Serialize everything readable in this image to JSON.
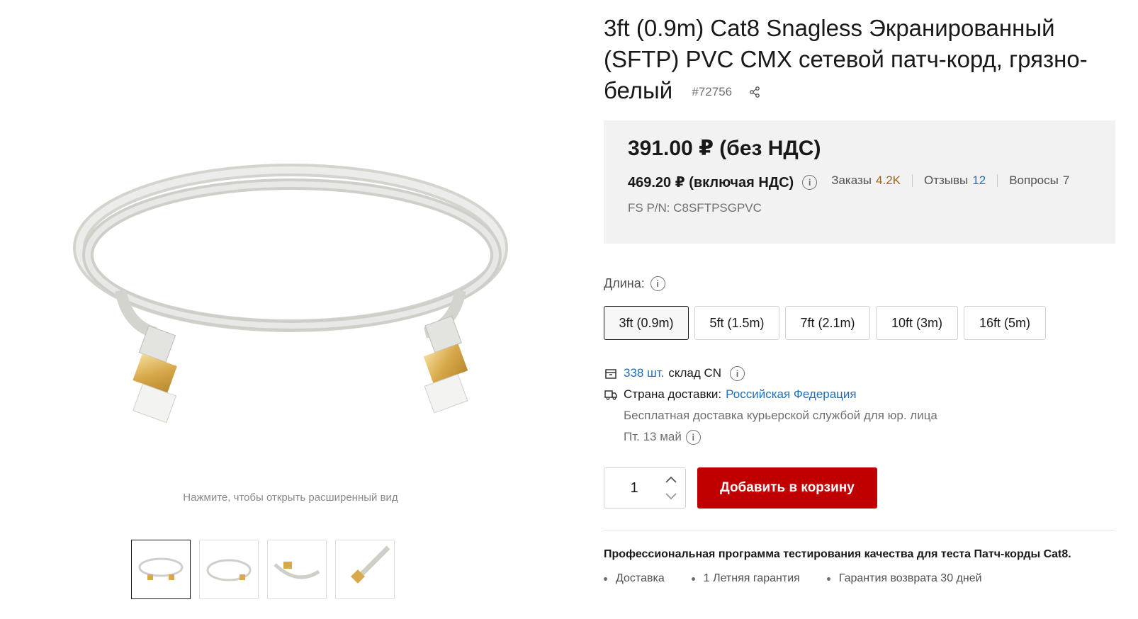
{
  "product": {
    "title": "3ft (0.9m) Cat8 Snagless Экранированный (SFTP) PVC CMX сетевой патч-корд, грязно-белый",
    "sku": "#72756"
  },
  "gallery": {
    "zoom_hint": "Нажмите, чтобы открыть расширенный вид"
  },
  "price": {
    "main": "391.00 ₽ (без НДС)",
    "with_vat": "469.20 ₽ (включая НДС)",
    "orders_label": "Заказы",
    "orders_value": "4.2K",
    "reviews_label": "Отзывы",
    "reviews_value": "12",
    "questions_label": "Вопросы",
    "questions_value": "7",
    "pn": "FS P/N: C8SFTPSGPVC"
  },
  "length": {
    "label": "Длина:",
    "options": [
      "3ft (0.9m)",
      "5ft (1.5m)",
      "7ft (2.1m)",
      "10ft (3m)",
      "16ft (5m)"
    ],
    "selected": "3ft (0.9m)"
  },
  "stock": {
    "qty": "338 шт.",
    "warehouse": "склад CN",
    "country_label": "Страна доставки:",
    "country": "Российская Федерация",
    "delivery_note": "Бесплатная доставка курьерской службой для юр. лица",
    "date": "Пт. 13 май"
  },
  "cart": {
    "quantity": "1",
    "add_label": "Добавить в корзину"
  },
  "quality": {
    "heading": "Профессиональная программа тестирования качества для теста Патч-корды Cat8.",
    "bullets": [
      "Доставка",
      "1 Летняя гарантия",
      "Гарантия возврата 30 дней"
    ]
  },
  "colors": {
    "accent": "#c00000",
    "link": "#1d6fbf",
    "orders": "#a0661a"
  }
}
